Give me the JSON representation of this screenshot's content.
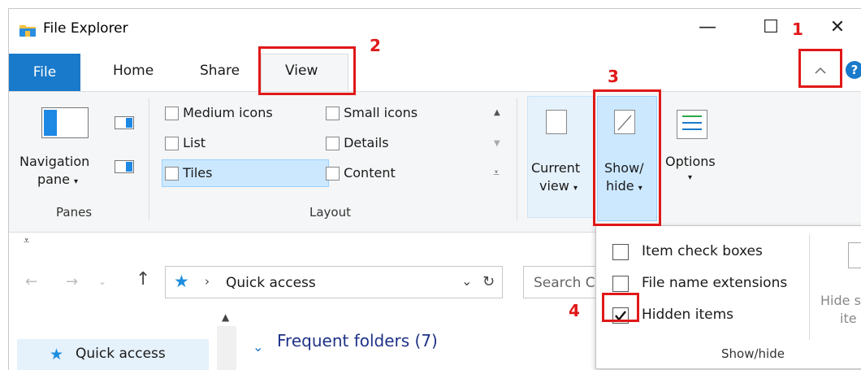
{
  "window": {
    "title": "File Explorer",
    "minimize": "—",
    "maximize": "☐",
    "close": "✕"
  },
  "tabs": {
    "file": "File",
    "home": "Home",
    "share": "Share",
    "view": "View"
  },
  "ribbon": {
    "panes": {
      "navigation_pane_line1": "Navigation",
      "navigation_pane_line2": "pane",
      "group_label": "Panes"
    },
    "layout": {
      "items": [
        "Medium icons",
        "Small icons",
        "List",
        "Details",
        "Tiles",
        "Content"
      ],
      "selected": "Tiles",
      "group_label": "Layout"
    },
    "current_view": {
      "line1": "Current",
      "line2": "view"
    },
    "show_hide": {
      "line1": "Show/",
      "line2": "hide"
    },
    "options": {
      "line1": "Options"
    }
  },
  "dropdown": {
    "items": [
      {
        "label": "Item check boxes",
        "checked": false
      },
      {
        "label": "File name extensions",
        "checked": false
      },
      {
        "label": "Hidden items",
        "checked": true
      }
    ],
    "hide_selected_line1": "Hide se",
    "hide_selected_line2": "ite",
    "group_label": "Show/hide"
  },
  "address": {
    "path": "Quick access",
    "search_placeholder": "Search C"
  },
  "nav_pane": {
    "quick_access": "Quick access"
  },
  "content": {
    "section_header": "Frequent folders (7)"
  },
  "annotations": {
    "one": "1",
    "two": "2",
    "three": "3",
    "four": "4"
  },
  "colors": {
    "accent_blue": "#1979ca",
    "annotation_red": "#e01818",
    "selection_blue": "#cce8ff"
  }
}
